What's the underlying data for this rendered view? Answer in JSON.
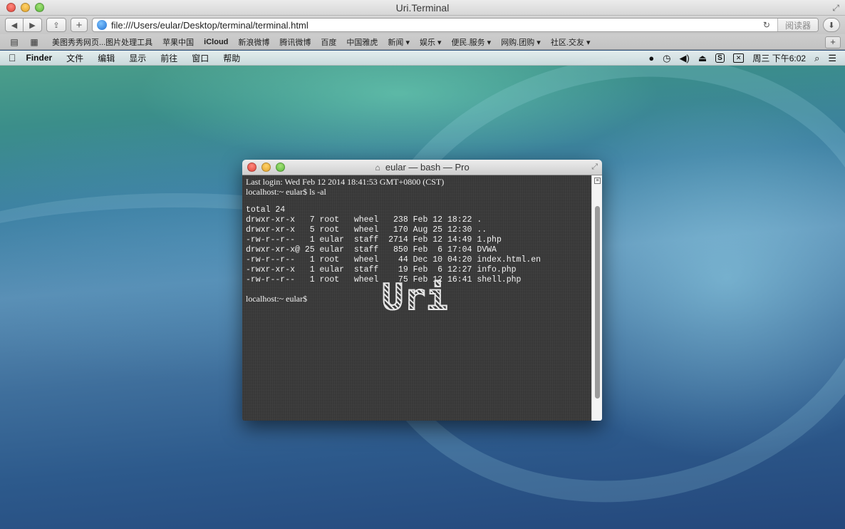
{
  "browser": {
    "window_title": "Uri.Terminal",
    "address": "file:///Users/eular/Desktop/terminal/terminal.html",
    "reader_label": "阅读器",
    "new_tab_label": "+",
    "add_label": "+"
  },
  "bookmarks": [
    {
      "label": "美图秀秀网页...图片处理工具"
    },
    {
      "label": "苹果中国"
    },
    {
      "label": "iCloud"
    },
    {
      "label": "新浪微博"
    },
    {
      "label": "腾讯微博"
    },
    {
      "label": "百度"
    },
    {
      "label": "中国雅虎"
    },
    {
      "label": "新闻 ▾"
    },
    {
      "label": "娱乐 ▾"
    },
    {
      "label": "便民.服务 ▾"
    },
    {
      "label": "网购.团购 ▾"
    },
    {
      "label": "社区.交友 ▾"
    }
  ],
  "menubar": {
    "app": "Finder",
    "items": [
      "文件",
      "编辑",
      "显示",
      "前往",
      "窗口",
      "帮助"
    ],
    "clock": "周三 下午6:02"
  },
  "terminal": {
    "title": "eular — bash — Pro",
    "last_login": "Last login: Wed Feb 12 2014 18:41:53 GMT+0800 (CST)",
    "prompt_cmd": "localhost:~ eular$ ls -al",
    "total": "total 24",
    "lines": [
      "drwxr-xr-x   7 root   wheel   238 Feb 12 18:22 .",
      "drwxr-xr-x   5 root   wheel   170 Aug 25 12:30 ..",
      "-rw-r--r--   1 eular  staff  2714 Feb 12 14:49 1.php",
      "drwxr-xr-x@ 25 eular  staff   850 Feb  6 17:04 DVWA",
      "-rw-r--r--   1 root   wheel    44 Dec 10 04:20 index.html.en",
      "-rwxr-xr-x   1 eular  staff    19 Feb  6 12:27 info.php",
      "-rw-r--r--   1 root   wheel    75 Feb 12 16:41 shell.php"
    ],
    "prompt": "localhost:~ eular$",
    "logo": "Uri"
  },
  "icons": {
    "back": "◀",
    "forward": "▶",
    "share": "⇪",
    "reload": "↻",
    "download": "⬇",
    "reading_list": "📖",
    "top_sites": "▦",
    "apple": "",
    "home": "⌂",
    "fullscreen": "⤢",
    "search": "⌕",
    "list": "☰",
    "volume": "◀)",
    "eject": "⏏",
    "time_machine": "◷"
  }
}
